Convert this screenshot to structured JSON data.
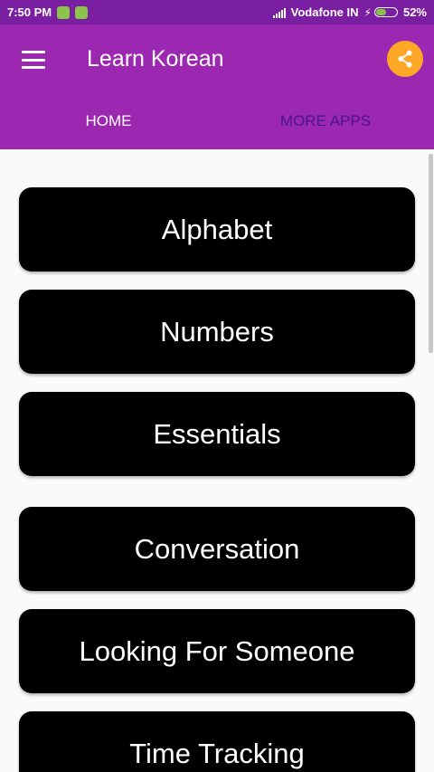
{
  "status_bar": {
    "time": "7:50 PM",
    "carrier": "Vodafone IN",
    "battery_percent": "52%",
    "battery_level": 0.52,
    "charging_glyph": "⚡"
  },
  "app_bar": {
    "title": "Learn Korean",
    "menu_icon": "hamburger-menu-icon",
    "share_icon": "share-icon"
  },
  "tabs": [
    {
      "label": "HOME",
      "selected": true
    },
    {
      "label": "MORE APPS",
      "selected": false
    }
  ],
  "menu": {
    "items": [
      {
        "label": "Alphabet"
      },
      {
        "label": "Numbers"
      },
      {
        "label": "Essentials"
      },
      {
        "label": "Conversation"
      },
      {
        "label": "Looking For Someone"
      },
      {
        "label": "Time Tracking"
      }
    ]
  },
  "colors": {
    "status_bar": "#7b1fa2",
    "app_bar": "#9c27b0",
    "accent": "#ffa726",
    "button": "#000000",
    "button_text": "#ffffff"
  }
}
